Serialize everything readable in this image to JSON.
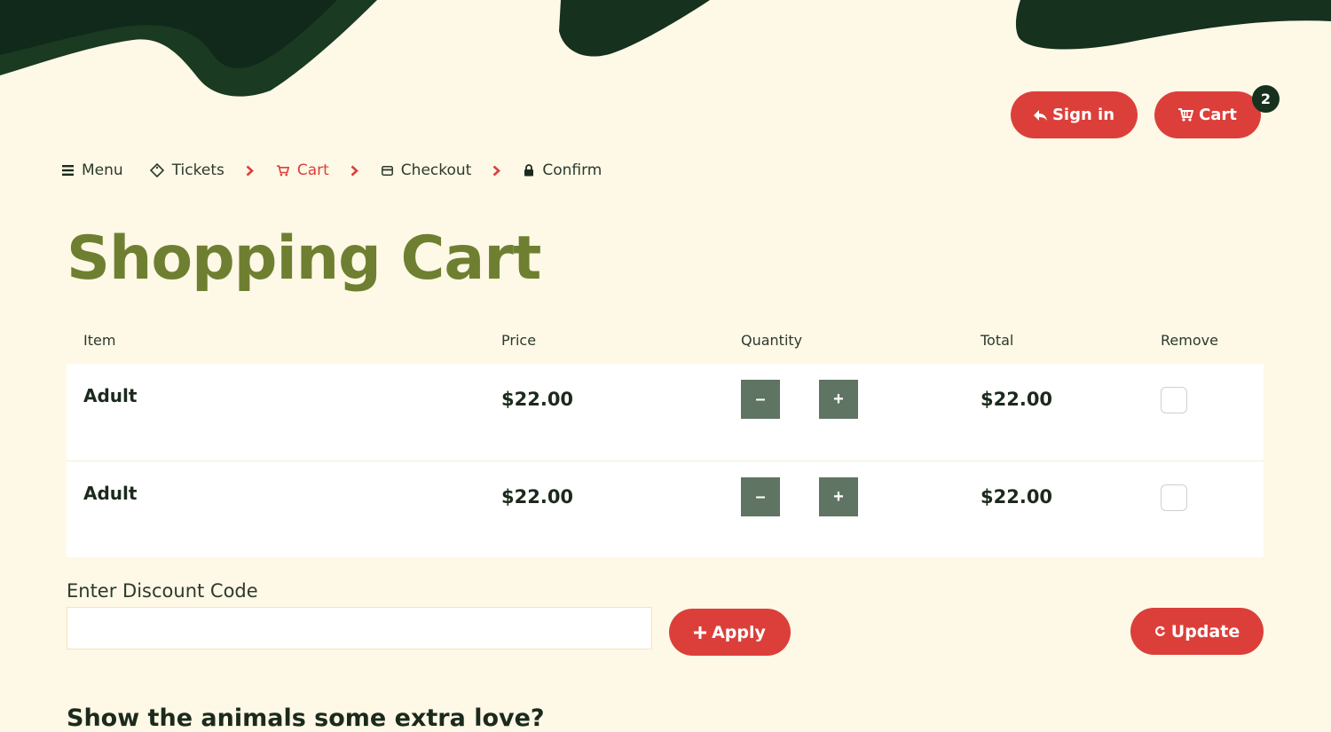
{
  "header": {
    "signin_label": "Sign in",
    "cart_label": "Cart",
    "cart_count": "2"
  },
  "breadcrumb": {
    "items": [
      {
        "label": "Menu",
        "icon": "hamburger-icon"
      },
      {
        "label": "Tickets",
        "icon": "ticket-icon"
      },
      {
        "label": "Cart",
        "icon": "cart-icon",
        "active": true
      },
      {
        "label": "Checkout",
        "icon": "card-icon"
      },
      {
        "label": "Confirm",
        "icon": "lock-icon"
      }
    ]
  },
  "page": {
    "title": "Shopping Cart"
  },
  "cart_table": {
    "columns": [
      "Item",
      "Price",
      "Quantity",
      "Total",
      "Remove"
    ],
    "rows": [
      {
        "item": "Adult",
        "price": "$22.00",
        "total": "$22.00",
        "minus_label": "–",
        "plus_label": "+"
      },
      {
        "item": "Adult",
        "price": "$22.00",
        "total": "$22.00",
        "minus_label": "–",
        "plus_label": "+"
      }
    ]
  },
  "discount": {
    "label": "Enter Discount Code",
    "value": "",
    "apply_label": "Apply"
  },
  "update_label": "Update",
  "extra_love_heading": "Show the animals some extra love?",
  "colors": {
    "background": "#fef8e6",
    "accent_red": "#dc3f3a",
    "dark_green": "#16311e",
    "title_olive": "#6f7f31",
    "qty_button": "#5f7462"
  }
}
